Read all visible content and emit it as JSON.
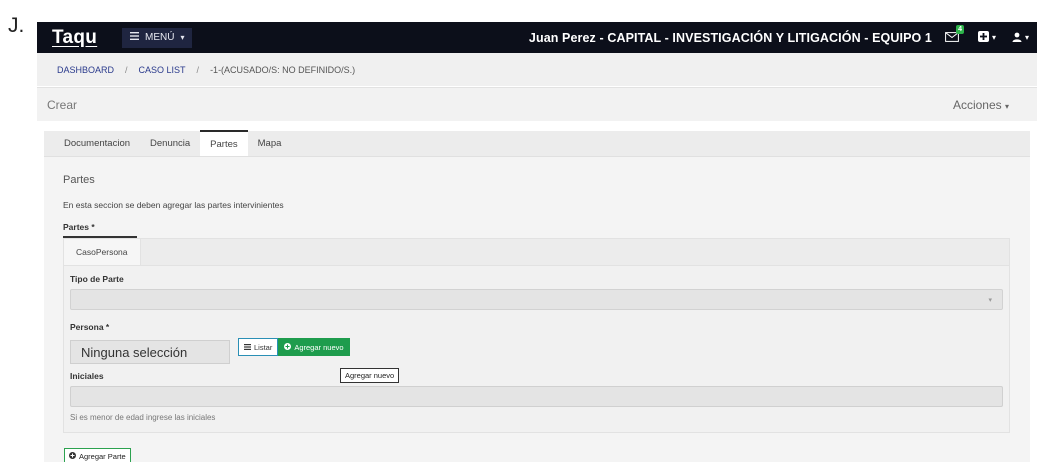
{
  "corner_label": "J.",
  "navbar": {
    "brand": "Taqu",
    "menu_label": "MENÚ",
    "user_title": "Juan Perez - CAPITAL - INVESTIGACIÓN Y LITIGACIÓN - EQUIPO 1",
    "mail_badge": "4",
    "bg_color": "#0c0f1a"
  },
  "breadcrumb": {
    "items": [
      "DASHBOARD",
      "CASO LIST",
      "-1-(ACUSADO/S: NO DEFINIDO/S.)"
    ],
    "separator": "/"
  },
  "actionbar": {
    "crear": "Crear",
    "acciones": "Acciones"
  },
  "tabs": [
    {
      "label": "Documentacion",
      "active": false
    },
    {
      "label": "Denuncia",
      "active": false
    },
    {
      "label": "Partes",
      "active": true
    },
    {
      "label": "Mapa",
      "active": false
    }
  ],
  "panel": {
    "title": "Partes",
    "description": "En esta seccion se deben agregar las partes intervinientes",
    "partes_label": "Partes *",
    "subtab": "CasoPersona",
    "tipo_parte_label": "Tipo de Parte",
    "persona_label": "Persona *",
    "persona_value": "Ninguna selección",
    "listar_label": "Listar",
    "agregar_nuevo_label": "Agregar nuevo",
    "tooltip_text": "Agregar nuevo",
    "iniciales_label": "Iniciales",
    "iniciales_help": "Si es menor de edad ingrese las iniciales",
    "agregar_parte_label": "Agregar Parte"
  },
  "colors": {
    "accent_green": "#1e9c4d",
    "accent_blue": "#2a8fb5"
  }
}
